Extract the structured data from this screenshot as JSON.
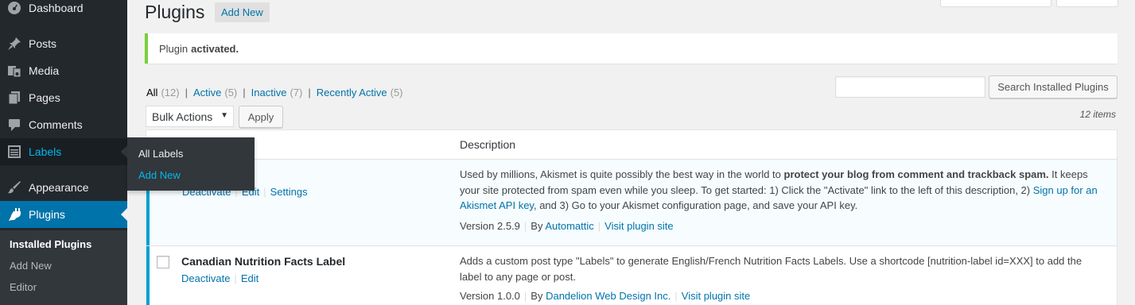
{
  "sidebar": {
    "menu": [
      {
        "label": "Dashboard",
        "icon": "dashboard-icon"
      },
      {
        "label": "Posts",
        "icon": "pushpin-icon"
      },
      {
        "label": "Media",
        "icon": "media-icon"
      },
      {
        "label": "Pages",
        "icon": "pages-icon"
      },
      {
        "label": "Comments",
        "icon": "comment-icon"
      },
      {
        "label": "Labels",
        "icon": "labels-icon"
      },
      {
        "label": "Appearance",
        "icon": "paintbrush-icon"
      },
      {
        "label": "Plugins",
        "icon": "plugin-icon"
      }
    ],
    "submenu": [
      "Installed Plugins",
      "Add New",
      "Editor"
    ],
    "flyout": [
      "All Labels",
      "Add New"
    ]
  },
  "header": {
    "title": "Plugins",
    "add_new": "Add New"
  },
  "notice": {
    "text": "Plugin",
    "bold": "activated."
  },
  "filters": {
    "all": {
      "label": "All",
      "count": "(12)"
    },
    "active": {
      "label": "Active",
      "count": "(5)"
    },
    "inactive": {
      "label": "Inactive",
      "count": "(7)"
    },
    "recent": {
      "label": "Recently Active",
      "count": "(5)"
    },
    "separator": "|"
  },
  "search": {
    "placeholder": "",
    "button": "Search Installed Plugins"
  },
  "bulk": {
    "selected": "Bulk Actions",
    "apply": "Apply",
    "items": "12 items"
  },
  "table": {
    "desc_header": "Description",
    "rows": [
      {
        "actions": [
          "Deactivate",
          "Edit",
          "Settings"
        ],
        "desc": {
          "p1": "Used by millions, Akismet is quite possibly the best way in the world to ",
          "b1": "protect your blog from comment and trackback spam.",
          "p2": " It keeps your site protected from spam even while you sleep. To get started: 1) Click the \"Activate\" link to the left of this description, 2) ",
          "a1": "Sign up for an Akismet API key",
          "p3": ", and 3) Go to your Akismet configuration page, and save your API key."
        },
        "version": "Version 2.5.9",
        "by": "By",
        "author": "Automattic",
        "site": "Visit plugin site"
      },
      {
        "title": "Canadian Nutrition Facts Label",
        "actions": [
          "Deactivate",
          "Edit"
        ],
        "desc": "Adds a custom post type \"Labels\" to generate English/French Nutrition Facts Labels. Use a shortcode [nutrition-label id=XXX] to add the label to any page or post.",
        "version": "Version 1.0.0",
        "by": "By",
        "author": "Dandelion Web Design Inc.",
        "site": "Visit plugin site"
      }
    ]
  },
  "colors": {
    "sidebar_bg": "#23282d",
    "accent": "#0073aa",
    "notice_green": "#7ad03a",
    "active_row_border": "#00a0d2"
  }
}
